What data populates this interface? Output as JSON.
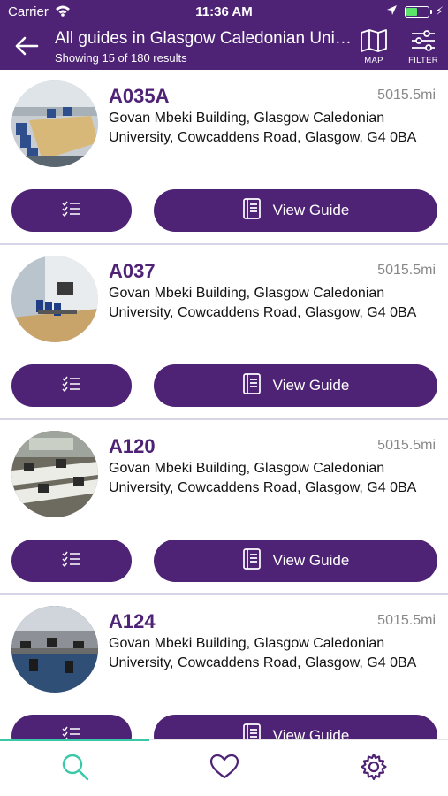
{
  "status": {
    "carrier": "Carrier",
    "time": "11:36 AM",
    "battery_level": 0.45
  },
  "header": {
    "title": "All guides in Glasgow Caledonian University",
    "subtitle": "Showing 15 of 180 results",
    "map_label": "MAP",
    "filter_label": "FILTER"
  },
  "colors": {
    "primary": "#4e2275",
    "accent": "#3ac8a8",
    "battery": "#5ce36a"
  },
  "results": [
    {
      "name": "A035A",
      "distance": "5015.5mi",
      "address": "Govan Mbeki Building, Glasgow Caledonian University, Cowcaddens Road, Glasgow, G4 0BA",
      "view_label": "View Guide"
    },
    {
      "name": "A037",
      "distance": "5015.5mi",
      "address": "Govan Mbeki Building, Glasgow Caledonian University, Cowcaddens Road, Glasgow, G4 0BA",
      "view_label": "View Guide"
    },
    {
      "name": "A120",
      "distance": "5015.5mi",
      "address": "Govan Mbeki Building, Glasgow Caledonian University, Cowcaddens Road, Glasgow, G4 0BA",
      "view_label": "View Guide"
    },
    {
      "name": "A124",
      "distance": "5015.5mi",
      "address": "Govan Mbeki Building, Glasgow Caledonian University, Cowcaddens Road, Glasgow, G4 0BA",
      "view_label": "View Guide"
    }
  ],
  "tabs": [
    {
      "icon": "search-icon",
      "active": true
    },
    {
      "icon": "heart-icon",
      "active": false
    },
    {
      "icon": "gear-icon",
      "active": false
    }
  ]
}
